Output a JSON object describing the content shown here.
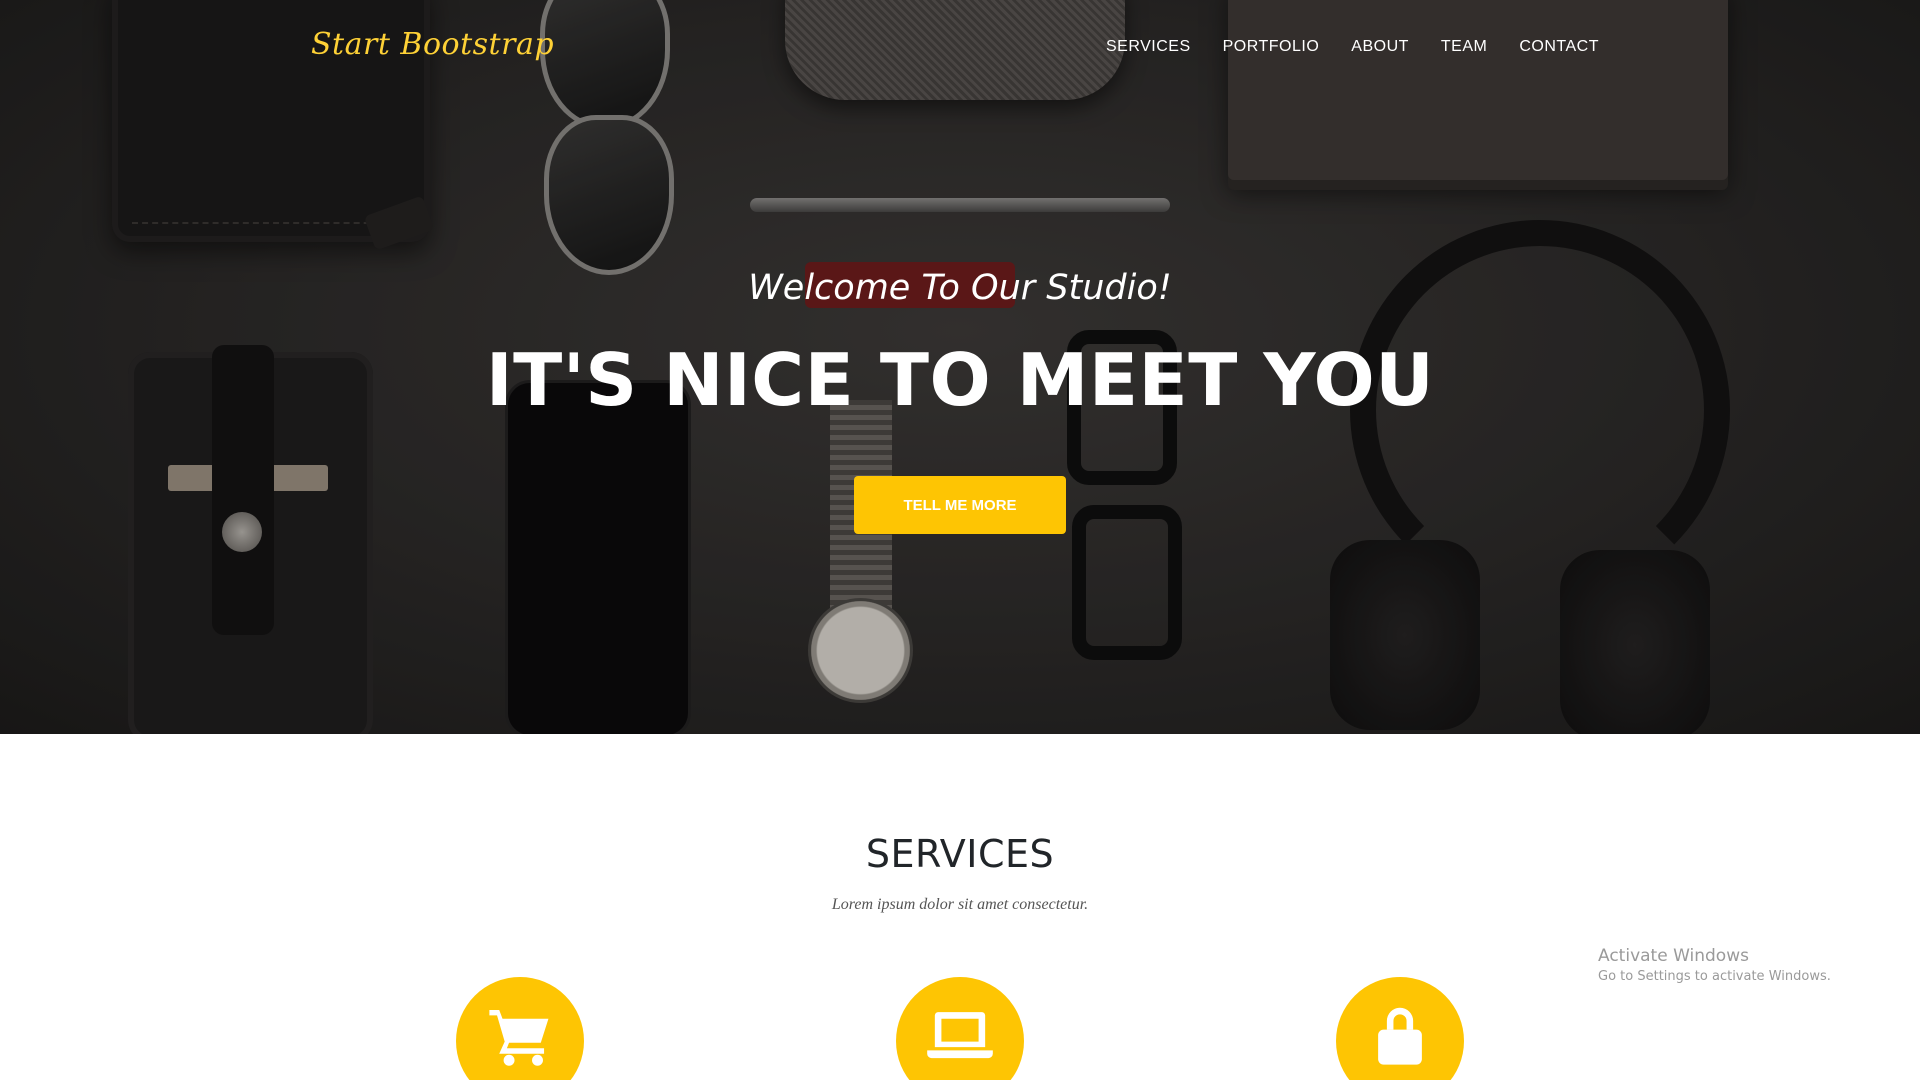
{
  "nav": {
    "brand": "Start Bootstrap",
    "links": [
      "SERVICES",
      "PORTFOLIO",
      "ABOUT",
      "TEAM",
      "CONTACT"
    ]
  },
  "hero": {
    "subheading": "Welcome To Our Studio!",
    "heading": "IT'S NICE TO MEET YOU",
    "cta_label": "TELL ME MORE"
  },
  "services": {
    "title": "SERVICES",
    "subtitle": "Lorem ipsum dolor sit amet consectetur.",
    "icons": [
      "shopping-cart-icon",
      "laptop-icon",
      "lock-icon"
    ]
  },
  "watermark": {
    "title": "Activate Windows",
    "subtitle": "Go to Settings to activate Windows."
  },
  "colors": {
    "accent": "#fec503",
    "brand": "#fed136",
    "text_dark": "#212529"
  }
}
